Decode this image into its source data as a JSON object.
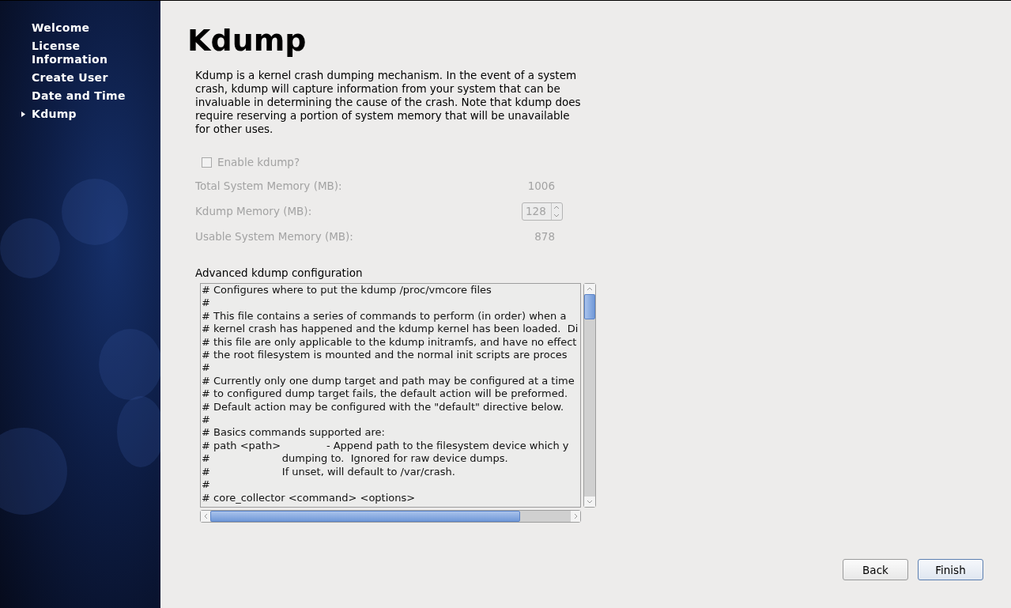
{
  "sidebar": {
    "items": [
      {
        "label": "Welcome",
        "selected": false
      },
      {
        "label": "License Information",
        "selected": false
      },
      {
        "label": "Create User",
        "selected": false
      },
      {
        "label": "Date and Time",
        "selected": false
      },
      {
        "label": "Kdump",
        "selected": true
      }
    ]
  },
  "title": "Kdump",
  "description": "Kdump is a kernel crash dumping mechanism. In the event of a system crash, kdump will capture information from your system that can be invaluable in determining the cause of the crash. Note that kdump does require reserving a portion of system memory that will be unavailable for other uses.",
  "enable_checkbox": {
    "label": "Enable kdump?",
    "checked": false,
    "disabled": true
  },
  "memory_rows": [
    {
      "kind": "value",
      "label": "Total System Memory (MB):",
      "value": "1006",
      "disabled": true
    },
    {
      "kind": "spinner",
      "label": "Kdump Memory (MB):",
      "value": "128",
      "disabled": true
    },
    {
      "kind": "value",
      "label": "Usable System Memory (MB):",
      "value": "878",
      "disabled": true
    }
  ],
  "advanced": {
    "label": "Advanced kdump configuration",
    "lines": [
      "# Configures where to put the kdump /proc/vmcore files",
      "#",
      "# This file contains a series of commands to perform (in order) when a",
      "# kernel crash has happened and the kdump kernel has been loaded.  Di",
      "# this file are only applicable to the kdump initramfs, and have no effect",
      "# the root filesystem is mounted and the normal init scripts are proces",
      "#",
      "# Currently only one dump target and path may be configured at a time",
      "# to configured dump target fails, the default action will be preformed.",
      "# Default action may be configured with the \"default\" directive below.",
      "#",
      "# Basics commands supported are:",
      "# path <path>              - Append path to the filesystem device which y",
      "#                      dumping to.  Ignored for raw device dumps.",
      "#                      If unset, will default to /var/crash.",
      "#",
      "# core_collector <command> <options>"
    ]
  },
  "buttons": [
    {
      "label": "Back",
      "selected": false
    },
    {
      "label": "Finish",
      "selected": true
    }
  ]
}
